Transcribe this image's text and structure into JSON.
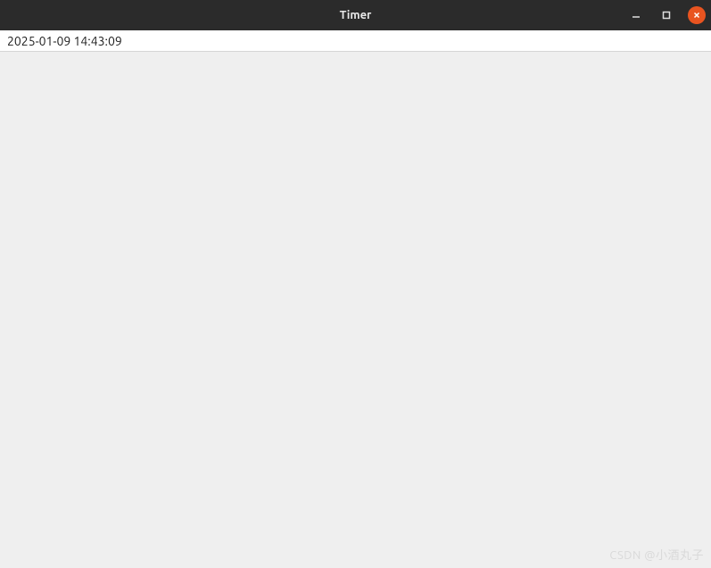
{
  "window": {
    "title": "Timer"
  },
  "icons": {
    "minimize": "minimize-icon",
    "maximize": "maximize-icon",
    "close": "close-icon"
  },
  "content": {
    "timestamp": "2025-01-09 14:43:09"
  },
  "watermark": "CSDN @小酒丸子"
}
